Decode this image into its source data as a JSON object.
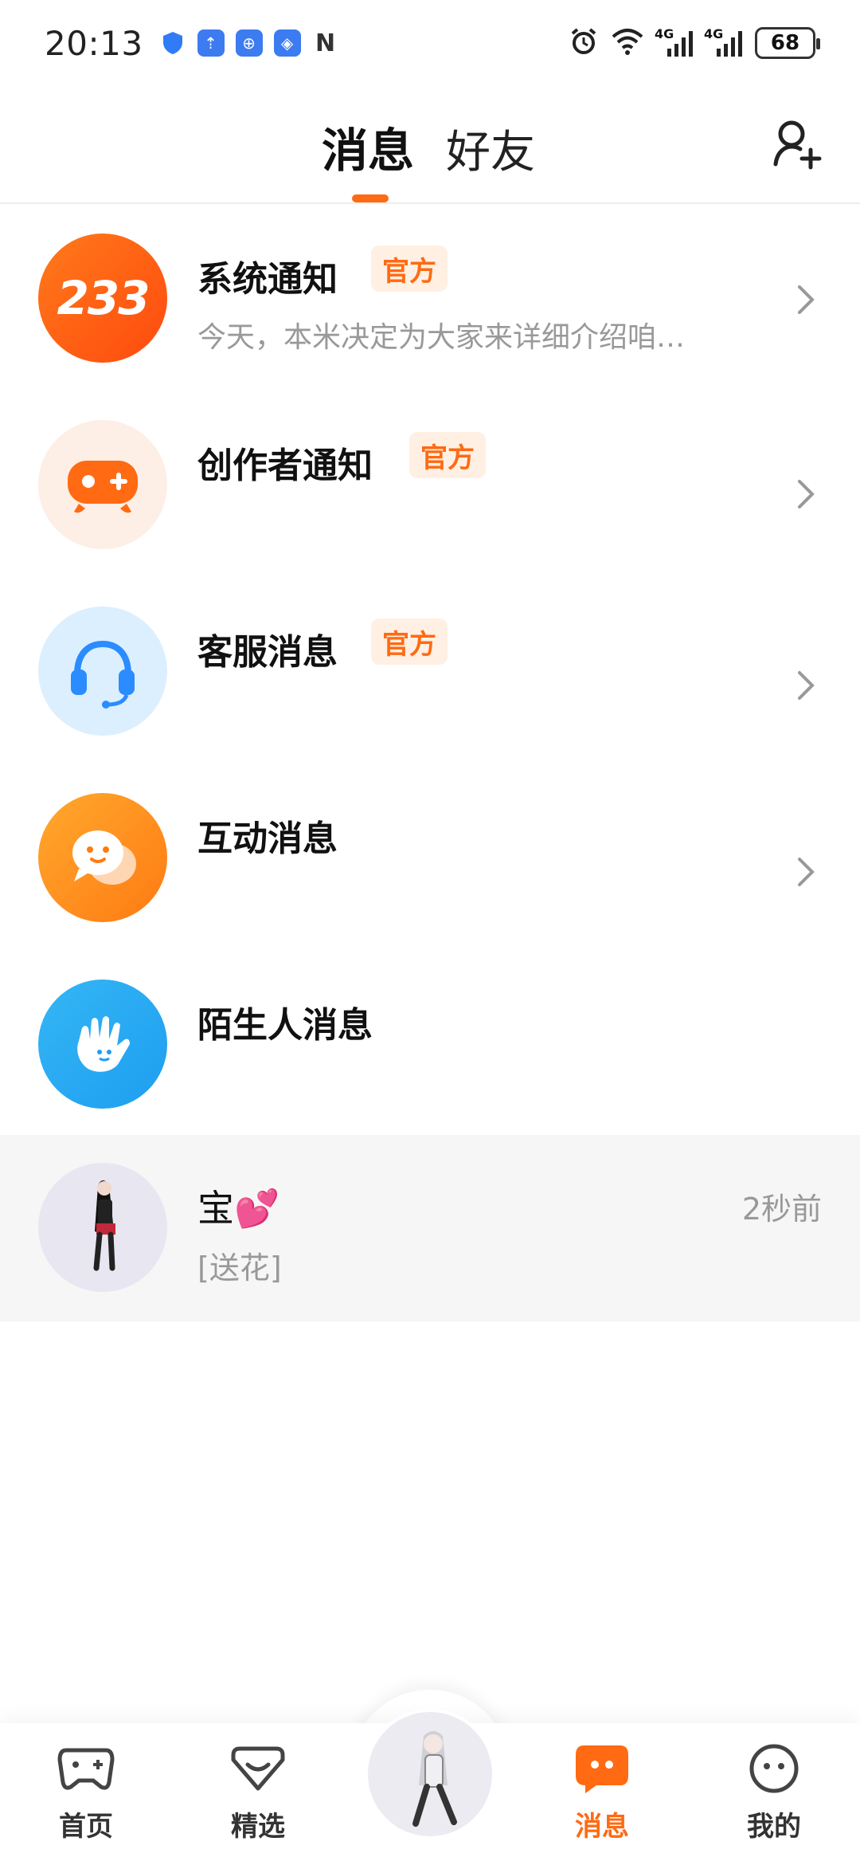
{
  "status_bar": {
    "time": "20:13",
    "signal_1": "4G",
    "signal_2": "4G",
    "battery": "68"
  },
  "header": {
    "tab_messages": "消息",
    "tab_friends": "好友",
    "accent_color": "#ff6a13"
  },
  "messages": {
    "items": [
      {
        "title": "系统通知",
        "badge": "官方",
        "subtitle": "今天，本米决定为大家来详细介绍咱…",
        "avatar_text": "233",
        "icon": "233-logo-icon"
      },
      {
        "title": "创作者通知",
        "badge": "官方",
        "subtitle": "",
        "icon": "gamepad-icon"
      },
      {
        "title": "客服消息",
        "badge": "官方",
        "subtitle": "",
        "icon": "headset-icon"
      },
      {
        "title": "互动消息",
        "subtitle": "",
        "icon": "chat-bubble-icon"
      },
      {
        "title": "陌生人消息",
        "subtitle": "",
        "icon": "hand-icon"
      }
    ],
    "chat": {
      "name": "宝💕",
      "last_message": "[送花]",
      "time": "2秒前"
    }
  },
  "bottom_nav": {
    "home": "首页",
    "featured": "精选",
    "messages": "消息",
    "mine": "我的"
  }
}
